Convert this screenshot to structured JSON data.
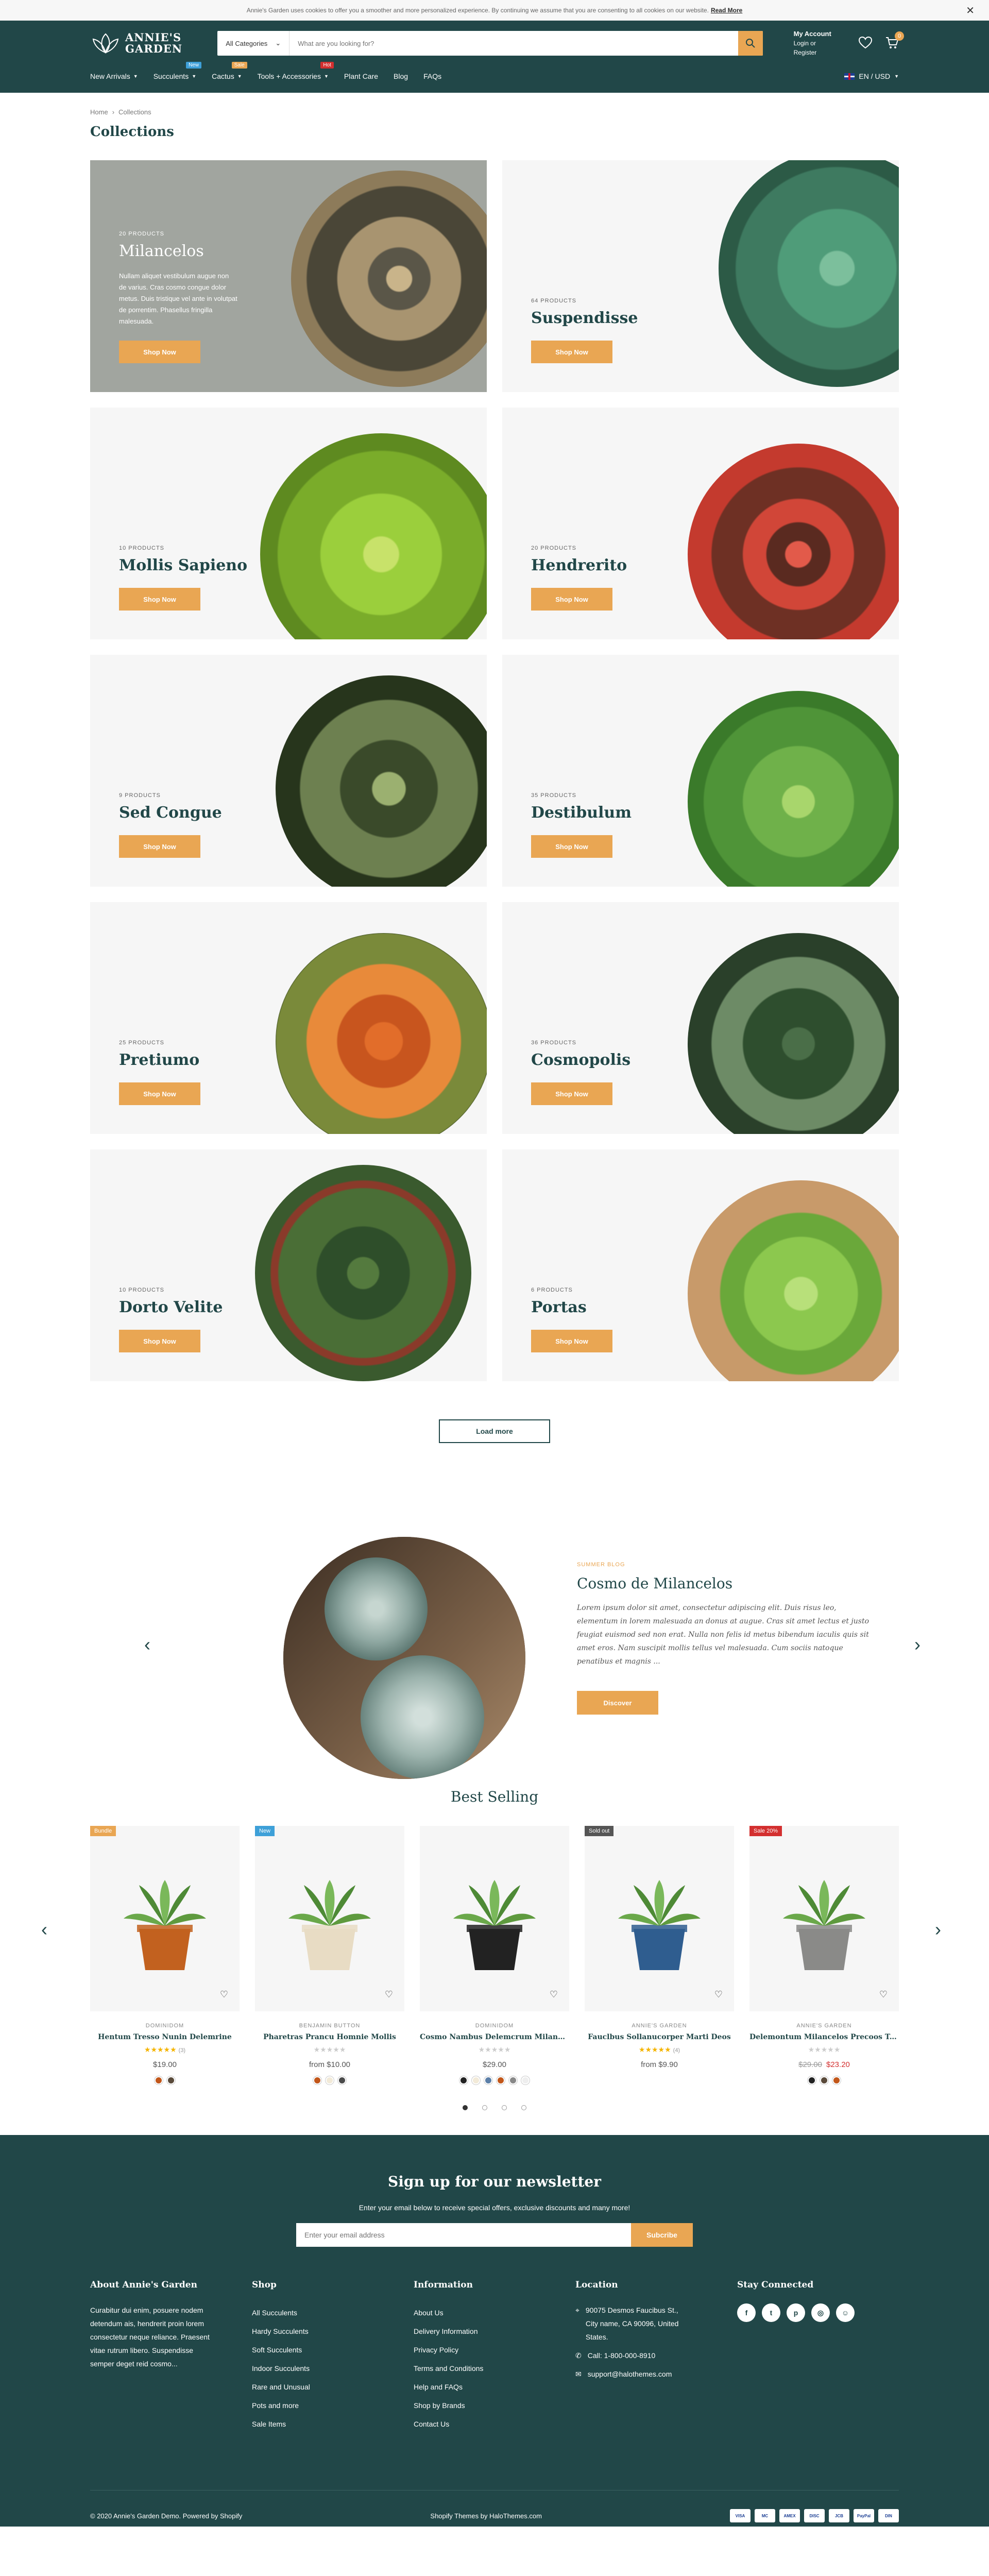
{
  "cookie": {
    "text": "Annie's Garden uses cookies to offer you a smoother and more personalized experience. By continuing we assume that you are consenting to all cookies on our website.",
    "link": "Read More"
  },
  "header": {
    "logo_line1": "ANNIE'S",
    "logo_line2": "GARDEN",
    "category": "All Categories",
    "search_placeholder": "What are you looking for?",
    "account_title": "My Account",
    "account_sub": "Login or Register",
    "cart_count": "0",
    "nav": [
      {
        "label": "New Arrivals",
        "chev": true,
        "badge": "",
        "badge_color": ""
      },
      {
        "label": "Succulents",
        "chev": true,
        "badge": "New",
        "badge_color": "#3ea0d8"
      },
      {
        "label": "Cactus",
        "chev": true,
        "badge": "Sale",
        "badge_color": "#e9a653"
      },
      {
        "label": "Tools + Accessories",
        "chev": true,
        "badge": "Hot",
        "badge_color": "#d32f2f"
      },
      {
        "label": "Plant Care",
        "chev": false,
        "badge": "",
        "badge_color": ""
      },
      {
        "label": "Blog",
        "chev": false,
        "badge": "",
        "badge_color": ""
      },
      {
        "label": "FAQs",
        "chev": false,
        "badge": "",
        "badge_color": ""
      }
    ],
    "lang": "EN / USD"
  },
  "breadcrumb": {
    "home": "Home",
    "current": "Collections"
  },
  "page_title": "Collections",
  "collections": [
    {
      "count": "20 PRODUCTS",
      "title": "Milancelos",
      "desc": "Nullam aliquet vestibulum augue non de varius. Cras cosmo congue dolor metus. Duis tristique vel ante in volutpat de porrentim. Phasellus fringilla malesuada.",
      "btn": "Shop Now",
      "featured": true
    },
    {
      "count": "64 PRODUCTS",
      "title": "Suspendisse",
      "desc": "",
      "btn": "Shop Now",
      "featured": false
    },
    {
      "count": "10 PRODUCTS",
      "title": "Mollis Sapieno",
      "desc": "",
      "btn": "Shop Now",
      "featured": false
    },
    {
      "count": "20 PRODUCTS",
      "title": "Hendrerito",
      "desc": "",
      "btn": "Shop Now",
      "featured": false
    },
    {
      "count": "9 PRODUCTS",
      "title": "Sed Congue",
      "desc": "",
      "btn": "Shop Now",
      "featured": false
    },
    {
      "count": "35 PRODUCTS",
      "title": "Destibulum",
      "desc": "",
      "btn": "Shop Now",
      "featured": false
    },
    {
      "count": "25 PRODUCTS",
      "title": "Pretiumo",
      "desc": "",
      "btn": "Shop Now",
      "featured": false
    },
    {
      "count": "36 PRODUCTS",
      "title": "Cosmopolis",
      "desc": "",
      "btn": "Shop Now",
      "featured": false
    },
    {
      "count": "10 PRODUCTS",
      "title": "Dorto Velite",
      "desc": "",
      "btn": "Shop Now",
      "featured": false
    },
    {
      "count": "6 PRODUCTS",
      "title": "Portas",
      "desc": "",
      "btn": "Shop Now",
      "featured": false
    }
  ],
  "load_more": "Load more",
  "spotlight": {
    "kicker": "SUMMER BLOG",
    "title": "Cosmo de Milancelos",
    "body": "Lorem ipsum dolor sit amet, consectetur adipiscing elit. Duis risus leo, elementum in lorem malesuada an donus at augue. Cras sit amet lectus et justo feugiat euismod sed non erat. Nulla non felis id metus bibendum iaculis quis sit amet eros. Nam suscipit mollis tellus vel malesuada. Cum sociis natoque penatibus et magnis ...",
    "btn": "Discover"
  },
  "best_selling": {
    "title": "Best Selling",
    "products": [
      {
        "tag": "Bundle",
        "tag_color": "#e9a653",
        "vendor": "DOMINIDOM",
        "name": "Hentum Tresso Nunin Delemrine",
        "stars": "★★★★★",
        "rating_count": "(3)",
        "rated": true,
        "price_old": "",
        "price": "$19.00",
        "sale": false,
        "swatches": [
          "#c2571a",
          "#5a4a3a"
        ],
        "pot": "#c2611f"
      },
      {
        "tag": "New",
        "tag_color": "#3ea0d8",
        "vendor": "BENJAMIN BUTTON",
        "name": "Pharetras Prancu Homnie Mollis",
        "stars": "★★★★★",
        "rating_count": "",
        "rated": false,
        "price_old": "",
        "price": "from $10.00",
        "sale": false,
        "swatches": [
          "#c2571a",
          "#f2ead8",
          "#4a4a4a"
        ],
        "pot": "#e8dcc4"
      },
      {
        "tag": "",
        "tag_color": "",
        "vendor": "DOMINIDOM",
        "name": "Cosmo Nambus Delemcrum Milance...",
        "stars": "★★★★★",
        "rating_count": "",
        "rated": false,
        "price_old": "",
        "price": "$29.00",
        "sale": false,
        "swatches": [
          "#222222",
          "#f2ead8",
          "#5c7fa8",
          "#c2571a",
          "#888888",
          "#eeeeee"
        ],
        "pot": "#222222"
      },
      {
        "tag": "Sold out",
        "tag_color": "#555555",
        "vendor": "ANNIE'S GARDEN",
        "name": "Fauclbus Sollanucorper Marti Deos",
        "stars": "★★★★★",
        "rating_count": "(4)",
        "rated": true,
        "price_old": "",
        "price": "from $9.90",
        "sale": false,
        "swatches": [],
        "pot": "#2f5d8f"
      },
      {
        "tag": "Sale 20%",
        "tag_color": "#d32f2f",
        "vendor": "ANNIE'S GARDEN",
        "name": "Delemontum Milancelos Precoos Tosmir",
        "stars": "★★★★★",
        "rating_count": "",
        "rated": false,
        "price_old": "$29.00",
        "price": "$23.20",
        "sale": true,
        "swatches": [
          "#222222",
          "#5a4a3a",
          "#c2571a"
        ],
        "pot": "#8a8a88"
      }
    ]
  },
  "footer": {
    "nl_title": "Sign up for our newsletter",
    "nl_text": "Enter your email below to receive special offers, exclusive discounts and many more!",
    "nl_placeholder": "Enter your email address",
    "nl_btn": "Subcribe",
    "about_title": "About Annie's Garden",
    "about_text": "Curabitur dui enim, posuere nodem detendum ais, hendrerit proin lorem consectetur neque reliance. Praesent vitae rutrum libero. Suspendisse semper deget reid cosmo...",
    "shop_title": "Shop",
    "shop_links": [
      "All Succulents",
      "Hardy Succulents",
      "Soft Succulents",
      "Indoor Succulents",
      "Rare and Unusual",
      "Pots and more",
      "Sale Items"
    ],
    "info_title": "Information",
    "info_links": [
      "About Us",
      "Delivery Information",
      "Privacy Policy",
      "Terms and Conditions",
      "Help and FAQs",
      "Shop by Brands",
      "Contact Us"
    ],
    "loc_title": "Location",
    "address": "90075 Desmos Faucibus St., City name, CA 90096, United States.",
    "phone": "Call: 1-800-000-8910",
    "email": "support@halothemes.com",
    "social_title": "Stay Connected",
    "copyright": "© 2020 Annie's Garden Demo. Powered by Shopify",
    "credit": "Shopify Themes by HaloThemes.com",
    "payments": [
      "VISA",
      "MC",
      "AMEX",
      "DISC",
      "JCB",
      "PayPal",
      "DIN"
    ]
  },
  "colors": {
    "brand": "#214748",
    "accent": "#e9a653"
  }
}
